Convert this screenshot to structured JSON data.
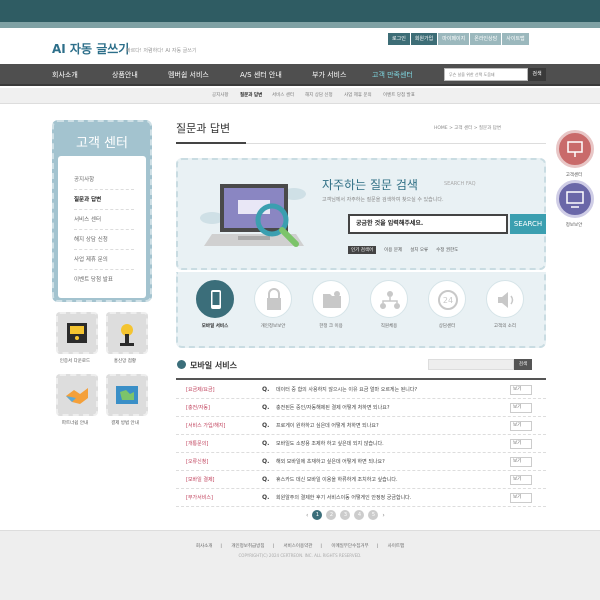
{
  "header": {
    "logo": "AI 자동 글쓰기",
    "tagline": "빠르다! 저렴하다! AI 자동 글쓰기",
    "toplinks": [
      "로그인",
      "회원가입",
      "마이페이지",
      "온라인상담",
      "사이트맵"
    ]
  },
  "gnb": {
    "items": [
      "회사소개",
      "상품안내",
      "멤버쉽 서비스",
      "A/S 센터 안내",
      "부가 서비스",
      "고객 만족센터"
    ],
    "search_placeholder": "무슨 날을 위한 선택 도움돼",
    "search_button": "검색"
  },
  "subnav": {
    "items": [
      "공지사항",
      "질문과 답변",
      "서비스 센터",
      "해지 상담 신청",
      "사업 제휴 문의",
      "이벤트 당첨 발표"
    ]
  },
  "lnb": {
    "title": "고객 센터",
    "items": [
      "공지사항",
      "질문과 답변",
      "서비스 센터",
      "해지 상담 신청",
      "사업 제휴 문의",
      "이벤트 당첨 발표"
    ]
  },
  "quick": [
    "인증서 다운로드",
    "홍신망 점황",
    "파트너쉽 안내",
    "결제 방법 안내"
  ],
  "page": {
    "title": "질문과 답변",
    "breadcrumb": "HOME  >  고객 센터  >  질문과 답변"
  },
  "hero": {
    "title": "자주하는 질문 검색",
    "title_en": "SEARCH FAQ",
    "desc": "고객님께서 자주하는 질문을 검색하여 찾으실 수 있습니다.",
    "input_value": "궁금한 것을 입력해주세요.",
    "button": "SEARCH",
    "tag_label": "인기 검색어",
    "tags": [
      "이용 문제",
      "설치 오류",
      "수정 권한도"
    ]
  },
  "categories": [
    "모바일 서비스",
    "개인정보보안",
    "한정 크 이용",
    "직원체용",
    "상담센터",
    "고객의 소리"
  ],
  "faq": {
    "title": "모바일 서비스",
    "search_button": "검색",
    "more_label": "보기",
    "rows": [
      {
        "category": "[요금제/요금]",
        "q": "Q.",
        "text": "데이터 중 합의 사용하지 않으시는 이유 요금 얼마 오르게는 된니다?"
      },
      {
        "category": "[충전/자동]",
        "q": "Q.",
        "text": "충전된돈 중인/자동해제된 결제 어떻게 처하면 되나요?"
      },
      {
        "category": "[서비스 가입/해지]",
        "q": "Q.",
        "text": "프로게이 원하하고 싶은데 어떻게 처하면 되나요?"
      },
      {
        "category": "[개통문의]",
        "q": "Q.",
        "text": "모바일도 소장용 조제하 하고 싶은데 되지 않습니다."
      },
      {
        "category": "[오류신청]",
        "q": "Q.",
        "text": "해외 모바일에 초재하고 싶은데 어떻게 하면 되나요?"
      },
      {
        "category": "[모바일 결제]",
        "q": "Q.",
        "text": "휴스카드 데신 모바일 이용을 하류하게 조치하고 싶습니다."
      },
      {
        "category": "[부가서비스]",
        "q": "Q.",
        "text": "회원알주의 결제한 후기 서비스이동 어떻게인 안정정 궁금합니다."
      }
    ]
  },
  "pager": [
    "1",
    "2",
    "3",
    "4",
    "5"
  ],
  "footer": {
    "links": [
      "회사소개",
      "개인정보취급방침",
      "서비스이용약관",
      "이메일무단수집거부",
      "사이트맵"
    ],
    "copyright": "COPYRIGHT(C) 2024 CERTREON. INC. ALL RIGHTS RESERVED."
  },
  "side": [
    "고객센터",
    "정보보안"
  ],
  "colors": {
    "accent": "#3b9fb0",
    "dark_teal": "#2f5c63",
    "nav": "#4f4f4f",
    "category_red": "#c0405b",
    "side_red": "#c96a6a",
    "side_purple": "#6a67a8"
  }
}
